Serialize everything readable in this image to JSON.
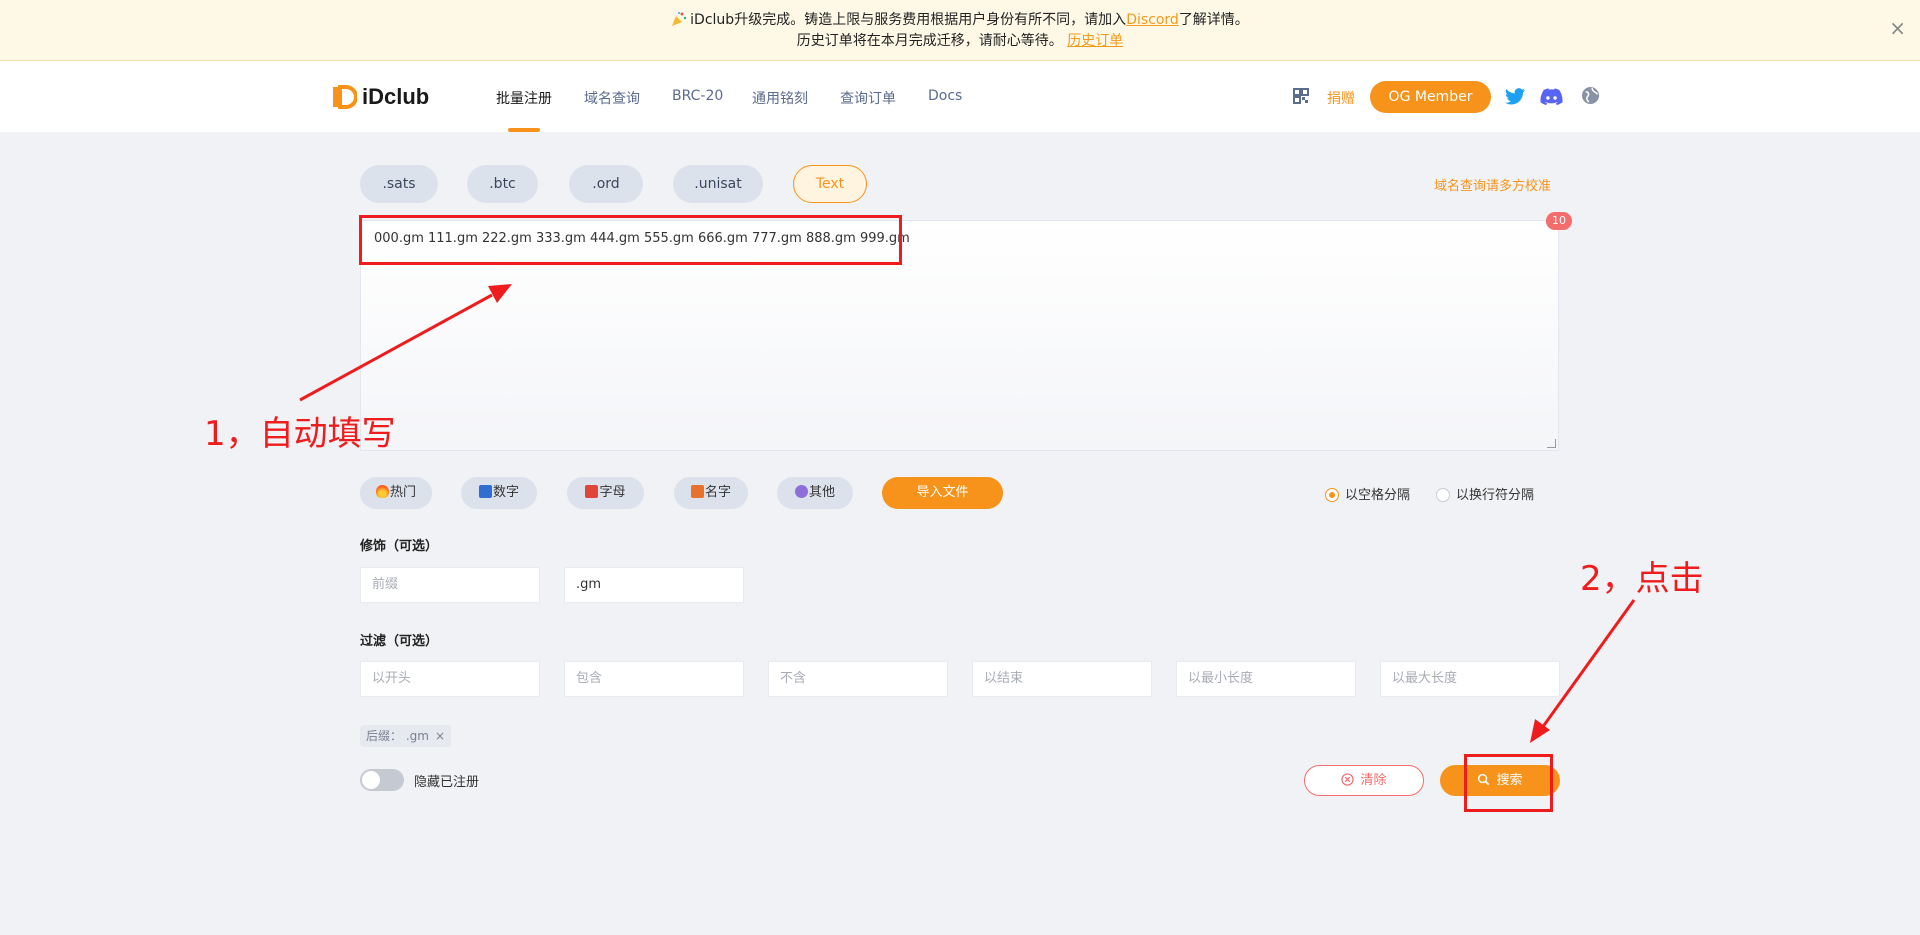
{
  "banner": {
    "line1_text": "iDclub升级完成。铸造上限与服务费用根据用户身份有所不同，请加入",
    "line1_link": "Discord",
    "line1_suffix": "了解详情。",
    "line2_text": "历史订单将在本月完成迁移，请耐心等待。",
    "line2_link": "历史订单",
    "close": "×"
  },
  "nav": {
    "logo": "iDclub",
    "items": [
      "批量注册",
      "域名查询",
      "BRC-20",
      "通用铭刻",
      "查询订单",
      "Docs"
    ],
    "donate": "捐赠",
    "og_member": "OG Member"
  },
  "tabs": [
    ".sats",
    ".btc",
    ".ord",
    ".unisat",
    "Text"
  ],
  "verify_link": "域名查询请多方校准",
  "textarea": {
    "value": "000.gm 111.gm 222.gm 333.gm 444.gm 555.gm 666.gm 777.gm 888.gm 999.gm",
    "count": "10"
  },
  "categories": [
    "热门",
    "数字",
    "字母",
    "名字",
    "其他"
  ],
  "import_button": "导入文件",
  "separators": {
    "space": "以空格分隔",
    "newline": "以换行符分隔",
    "selected": "space"
  },
  "decoration": {
    "label": "修饰（可选）",
    "prefix_placeholder": "前缀",
    "suffix_value": ".gm"
  },
  "filter": {
    "label": "过滤（可选）",
    "placeholders": [
      "以开头",
      "包含",
      "不含",
      "以结束",
      "以最小长度",
      "以最大长度"
    ]
  },
  "active_tag": {
    "text": "后缀： .gm",
    "remove": "×"
  },
  "hide_registered": {
    "label": "隐藏已注册",
    "on": false
  },
  "buttons": {
    "clear": "清除",
    "search": "搜索"
  },
  "annotations": {
    "step1": "1，自动填写",
    "step2": "2，点击"
  },
  "colors": {
    "accent": "#f7931a",
    "danger": "#f56c6c",
    "annotation": "#ee1c1c"
  }
}
